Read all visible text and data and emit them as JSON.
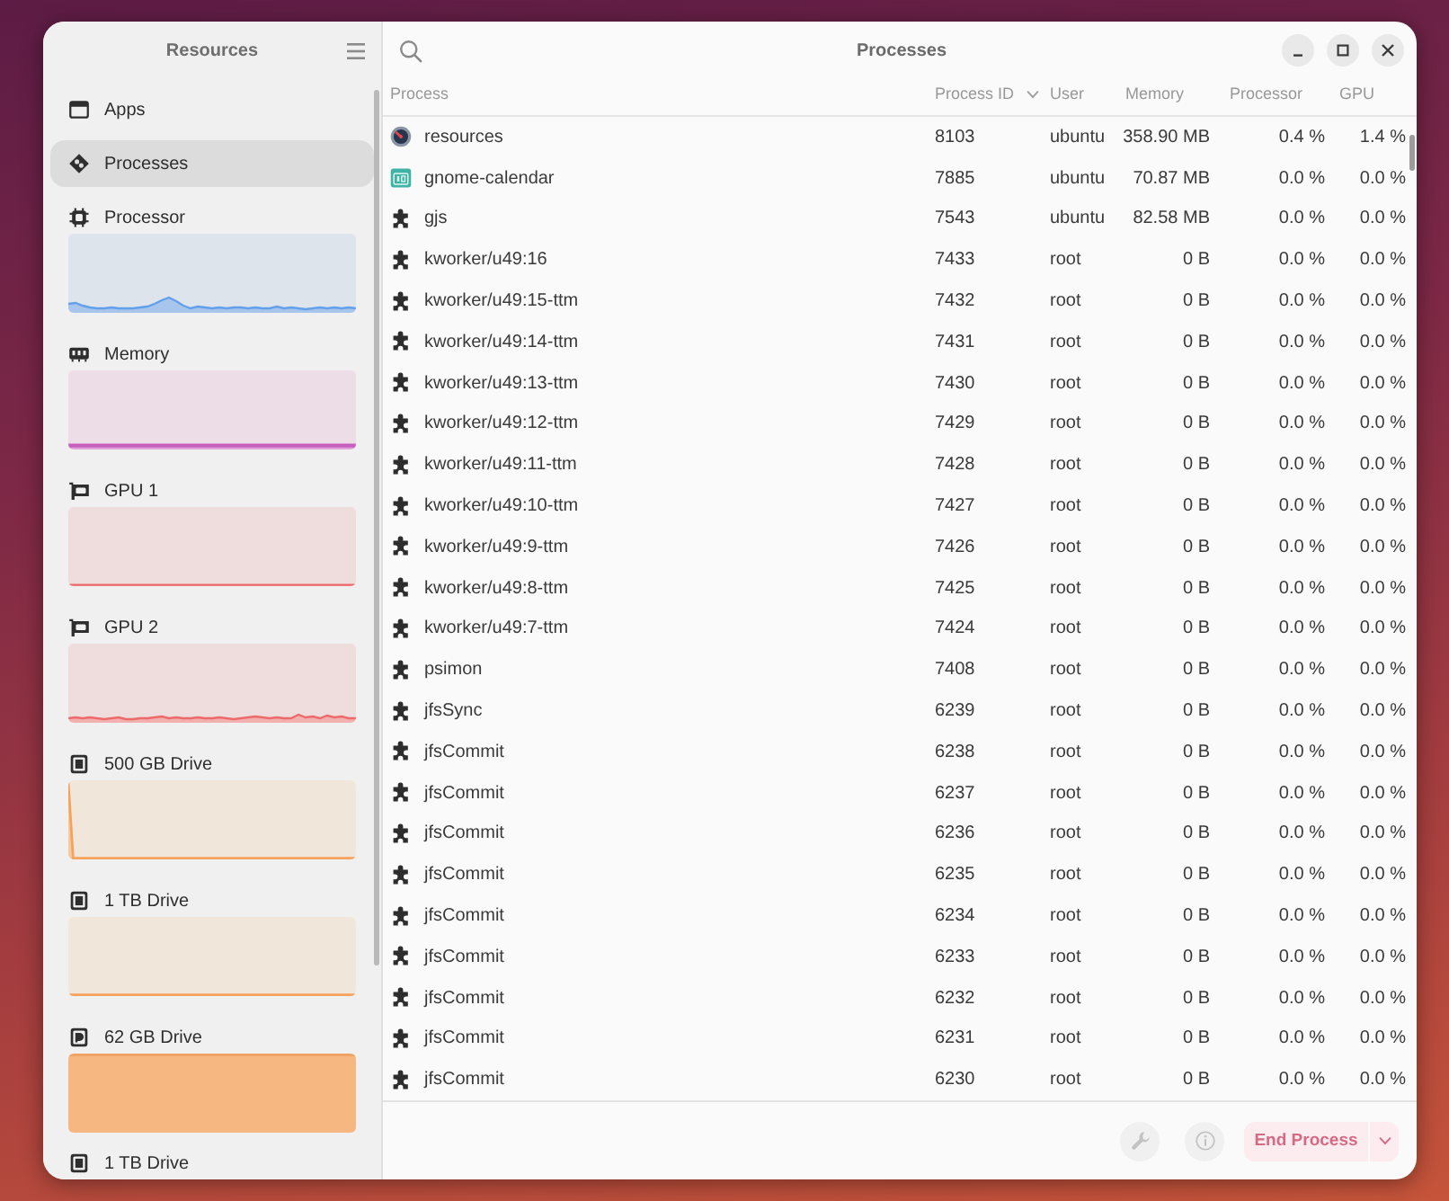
{
  "sidebar": {
    "title": "Resources",
    "items": [
      {
        "label": "Apps",
        "kind": "apps",
        "selected": false
      },
      {
        "label": "Processes",
        "kind": "processes",
        "selected": true
      },
      {
        "label": "Processor",
        "kind": "cpu",
        "selected": false
      },
      {
        "label": "Memory",
        "kind": "memory",
        "selected": false
      },
      {
        "label": "GPU 1",
        "kind": "gpu",
        "selected": false
      },
      {
        "label": "GPU 2",
        "kind": "gpu",
        "selected": false
      },
      {
        "label": "500 GB Drive",
        "kind": "drive",
        "selected": false
      },
      {
        "label": "1 TB Drive",
        "kind": "drive",
        "selected": false
      },
      {
        "label": "62 GB Drive",
        "kind": "removable-drive",
        "selected": false
      },
      {
        "label": "1 TB Drive",
        "kind": "drive",
        "selected": false
      }
    ]
  },
  "header": {
    "title": "Processes"
  },
  "table": {
    "columns": [
      {
        "label": "Process",
        "sorted": false
      },
      {
        "label": "Process ID",
        "sorted": true
      },
      {
        "label": "User",
        "sorted": false
      },
      {
        "label": "Memory",
        "sorted": false
      },
      {
        "label": "Processor",
        "sorted": false
      },
      {
        "label": "GPU",
        "sorted": false
      }
    ],
    "rows": [
      {
        "kind": "monitor-app",
        "name": "resources",
        "pid": "8103",
        "user": "ubuntu",
        "memory": "358.90 MB",
        "processor": "0.4 %",
        "gpu": "1.4 %"
      },
      {
        "kind": "calendar-app",
        "name": "gnome-calendar",
        "pid": "7885",
        "user": "ubuntu",
        "memory": "70.87 MB",
        "processor": "0.0 %",
        "gpu": "0.0 %"
      },
      {
        "kind": "process",
        "name": "gjs",
        "pid": "7543",
        "user": "ubuntu",
        "memory": "82.58 MB",
        "processor": "0.0 %",
        "gpu": "0.0 %"
      },
      {
        "kind": "process",
        "name": "kworker/u49:16",
        "pid": "7433",
        "user": "root",
        "memory": "0 B",
        "processor": "0.0 %",
        "gpu": "0.0 %"
      },
      {
        "kind": "process",
        "name": "kworker/u49:15-ttm",
        "pid": "7432",
        "user": "root",
        "memory": "0 B",
        "processor": "0.0 %",
        "gpu": "0.0 %"
      },
      {
        "kind": "process",
        "name": "kworker/u49:14-ttm",
        "pid": "7431",
        "user": "root",
        "memory": "0 B",
        "processor": "0.0 %",
        "gpu": "0.0 %"
      },
      {
        "kind": "process",
        "name": "kworker/u49:13-ttm",
        "pid": "7430",
        "user": "root",
        "memory": "0 B",
        "processor": "0.0 %",
        "gpu": "0.0 %"
      },
      {
        "kind": "process",
        "name": "kworker/u49:12-ttm",
        "pid": "7429",
        "user": "root",
        "memory": "0 B",
        "processor": "0.0 %",
        "gpu": "0.0 %"
      },
      {
        "kind": "process",
        "name": "kworker/u49:11-ttm",
        "pid": "7428",
        "user": "root",
        "memory": "0 B",
        "processor": "0.0 %",
        "gpu": "0.0 %"
      },
      {
        "kind": "process",
        "name": "kworker/u49:10-ttm",
        "pid": "7427",
        "user": "root",
        "memory": "0 B",
        "processor": "0.0 %",
        "gpu": "0.0 %"
      },
      {
        "kind": "process",
        "name": "kworker/u49:9-ttm",
        "pid": "7426",
        "user": "root",
        "memory": "0 B",
        "processor": "0.0 %",
        "gpu": "0.0 %"
      },
      {
        "kind": "process",
        "name": "kworker/u49:8-ttm",
        "pid": "7425",
        "user": "root",
        "memory": "0 B",
        "processor": "0.0 %",
        "gpu": "0.0 %"
      },
      {
        "kind": "process",
        "name": "kworker/u49:7-ttm",
        "pid": "7424",
        "user": "root",
        "memory": "0 B",
        "processor": "0.0 %",
        "gpu": "0.0 %"
      },
      {
        "kind": "process",
        "name": "psimon",
        "pid": "7408",
        "user": "root",
        "memory": "0 B",
        "processor": "0.0 %",
        "gpu": "0.0 %"
      },
      {
        "kind": "process",
        "name": "jfsSync",
        "pid": "6239",
        "user": "root",
        "memory": "0 B",
        "processor": "0.0 %",
        "gpu": "0.0 %"
      },
      {
        "kind": "process",
        "name": "jfsCommit",
        "pid": "6238",
        "user": "root",
        "memory": "0 B",
        "processor": "0.0 %",
        "gpu": "0.0 %"
      },
      {
        "kind": "process",
        "name": "jfsCommit",
        "pid": "6237",
        "user": "root",
        "memory": "0 B",
        "processor": "0.0 %",
        "gpu": "0.0 %"
      },
      {
        "kind": "process",
        "name": "jfsCommit",
        "pid": "6236",
        "user": "root",
        "memory": "0 B",
        "processor": "0.0 %",
        "gpu": "0.0 %"
      },
      {
        "kind": "process",
        "name": "jfsCommit",
        "pid": "6235",
        "user": "root",
        "memory": "0 B",
        "processor": "0.0 %",
        "gpu": "0.0 %"
      },
      {
        "kind": "process",
        "name": "jfsCommit",
        "pid": "6234",
        "user": "root",
        "memory": "0 B",
        "processor": "0.0 %",
        "gpu": "0.0 %"
      },
      {
        "kind": "process",
        "name": "jfsCommit",
        "pid": "6233",
        "user": "root",
        "memory": "0 B",
        "processor": "0.0 %",
        "gpu": "0.0 %"
      },
      {
        "kind": "process",
        "name": "jfsCommit",
        "pid": "6232",
        "user": "root",
        "memory": "0 B",
        "processor": "0.0 %",
        "gpu": "0.0 %"
      },
      {
        "kind": "process",
        "name": "jfsCommit",
        "pid": "6231",
        "user": "root",
        "memory": "0 B",
        "processor": "0.0 %",
        "gpu": "0.0 %"
      },
      {
        "kind": "process",
        "name": "jfsCommit",
        "pid": "6230",
        "user": "root",
        "memory": "0 B",
        "processor": "0.0 %",
        "gpu": "0.0 %"
      }
    ]
  },
  "footer": {
    "tools": [
      {
        "kind": "wrench",
        "disabled": true
      },
      {
        "kind": "info",
        "disabled": true
      }
    ],
    "end_button": {
      "label": "End Process",
      "disabled": true
    }
  }
}
